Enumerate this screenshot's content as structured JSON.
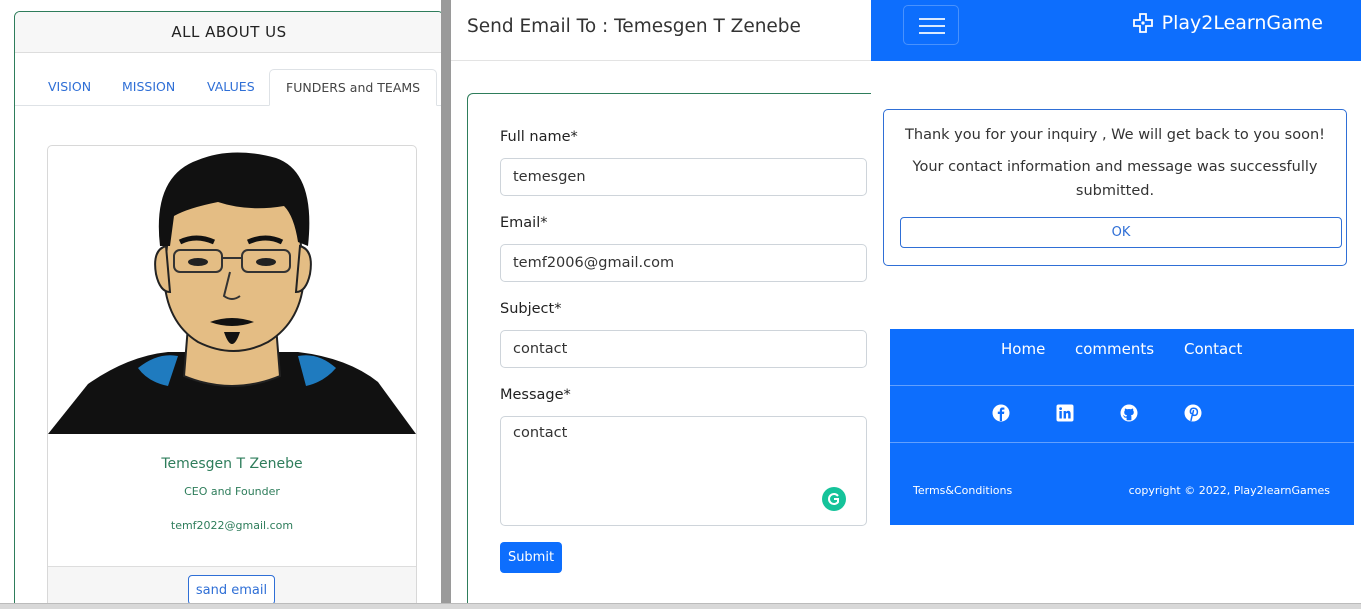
{
  "about": {
    "header": "ALL ABOUT US",
    "tabs": [
      {
        "label": "VISION"
      },
      {
        "label": "MISSION"
      },
      {
        "label": "VALUES"
      },
      {
        "label": "FUNDERS and TEAMS"
      }
    ],
    "profile": {
      "name": "Temesgen T Zenebe",
      "role": "CEO and Founder",
      "email": "temf2022@gmail.com",
      "button_label": "sand email"
    }
  },
  "email_modal": {
    "title": "Send Email To :  Temesgen T Zenebe",
    "fields": {
      "full_name": {
        "label": "Full name*",
        "value": "temesgen"
      },
      "email": {
        "label": "Email*",
        "value": "temf2006@gmail.com"
      },
      "subject": {
        "label": "Subject*",
        "value": "contact"
      },
      "message": {
        "label": "Message*",
        "value": "contact"
      }
    },
    "submit_label": "Submit"
  },
  "site": {
    "brand": "Play2LearnGame",
    "alert": {
      "line1": "Thank you for your inquiry , We will get back to you soon!",
      "line2": "Your contact information and message was successfully submitted.",
      "ok_label": "OK"
    },
    "footer": {
      "nav": [
        {
          "label": "Home"
        },
        {
          "label": "comments"
        },
        {
          "label": "Contact"
        }
      ],
      "social_icons": [
        "facebook-icon",
        "linkedin-icon",
        "github-icon",
        "pinterest-icon"
      ],
      "terms": "Terms&Conditions",
      "copyright": "copyright © 2022, Play2learnGames"
    }
  },
  "colors": {
    "primary": "#0d6efd",
    "accent_green": "#2e7d5b",
    "link_blue": "#2f6fd6"
  }
}
